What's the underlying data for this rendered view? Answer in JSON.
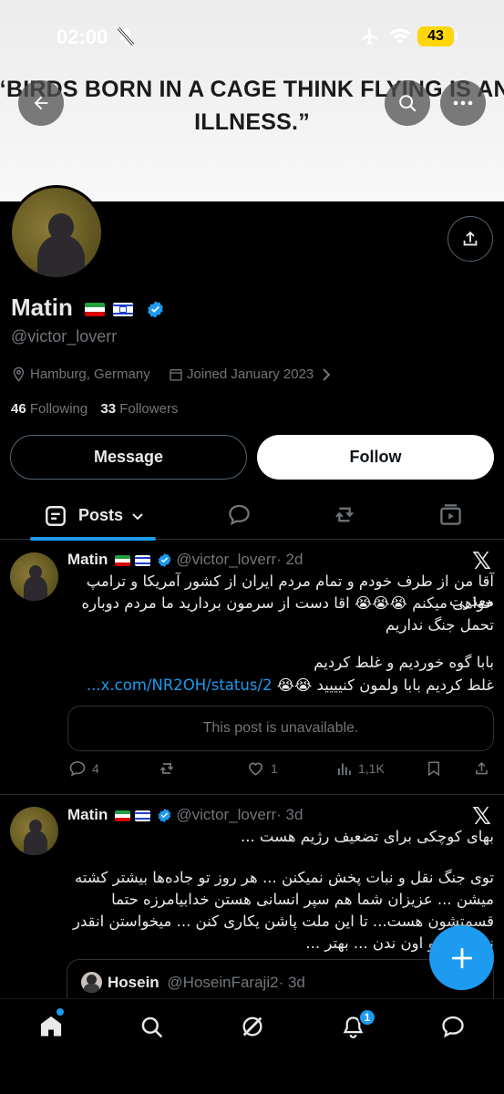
{
  "status_bar": {
    "time": "02:00",
    "battery": "43"
  },
  "banner": {
    "line1": "“BIRDS BORN IN A CAGE THINK FLYING IS AN",
    "line2": "ILLNESS.”"
  },
  "profile": {
    "name": "Matin",
    "handle": "@victor_loverr",
    "location": "Hamburg, Germany",
    "joined": "Joined January 2023",
    "following_count": "46",
    "following_label": "Following",
    "followers_count": "33",
    "followers_label": "Followers",
    "message_label": "Message",
    "follow_label": "Follow"
  },
  "tabs": {
    "posts_label": "Posts"
  },
  "posts": [
    {
      "name": "Matin",
      "handle": "@victor_loverr",
      "time": "· 2d",
      "line1": "آقا من از طرف خودم و تمام مردم ایران از کشور آمریکا و ترامپ معذرت",
      "line2": "خواهی میکنم 😭😭😭 اقا دست از سرمون بردارید ما مردم دوباره",
      "line3": "تحمل جنگ نداریم",
      "line4": "بابا گوه خوردیم و غلط کردیم",
      "line5_text": "غلط کردیم بابا ولمون کنیییید 😭😭 ",
      "line5_link": "x.com/NR2OH/status/2...",
      "unavailable": "This post is unavailable.",
      "replies": "4",
      "likes": "1",
      "views": "1,1K"
    },
    {
      "name": "Matin",
      "handle": "@victor_loverr",
      "time": "· 3d",
      "line1": "بهای کوچکی برای تضعیف رژیم هست ...",
      "line2": "توی جنگ نقل و نبات پخش نمیکنن ... هر روز تو جاده‌ها بیشتر کشته",
      "line3": "میشن ... عزیزان شما هم سپر انسانی هستن خدابیامرزه حتما",
      "line4": "قسمتشون هست... تا این ملت پاشن یکاری کنن ... میخواستن انقدر",
      "line5": "نه بر این و اون ندن ... بهتر ...",
      "quoted_name": "Hosein",
      "quoted_handle": "@HoseinFaraji2",
      "quoted_time": "· 3d"
    }
  ],
  "nav": {
    "notifications_badge": "1"
  },
  "colors": {
    "accent": "#1d9bf0",
    "background": "#000000",
    "muted": "#71767b"
  }
}
